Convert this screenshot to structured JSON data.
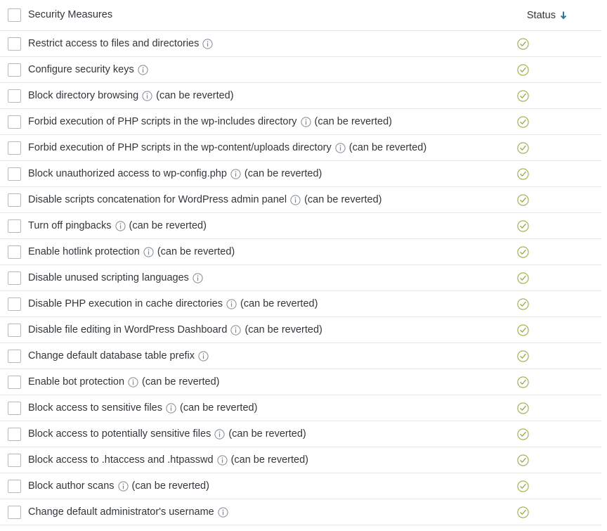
{
  "header": {
    "select_all_checkbox": "unchecked",
    "title": "Security Measures",
    "status_label": "Status",
    "sort_icon": "arrow-down-icon",
    "sort_direction": "descending"
  },
  "colors": {
    "status_ok": "#9aab3f",
    "sort_arrow": "#2a7b9b",
    "text": "#32373c",
    "border": "#e8e8e8",
    "checkbox_border": "#b4b9be",
    "info_icon": "#7e8993",
    "background": "#ffffff"
  },
  "icons": {
    "info": "info-circle-icon",
    "status_ok": "check-circle-icon",
    "checkbox": "checkbox-unchecked-icon"
  },
  "table": {
    "columns": [
      "Security Measures",
      "Status"
    ],
    "rows": [
      {
        "label": "Restrict access to files and directories",
        "info": true,
        "revertable": "",
        "status": "ok",
        "checked": false
      },
      {
        "label": "Configure security keys",
        "info": true,
        "revertable": "",
        "status": "ok",
        "checked": false
      },
      {
        "label": "Block directory browsing",
        "info": true,
        "revertable": "(can be reverted)",
        "status": "ok",
        "checked": false
      },
      {
        "label": "Forbid execution of PHP scripts in the wp-includes directory",
        "info": true,
        "revertable": "(can be reverted)",
        "status": "ok",
        "checked": false
      },
      {
        "label": "Forbid execution of PHP scripts in the wp-content/uploads directory",
        "info": true,
        "revertable": "(can be reverted)",
        "status": "ok",
        "checked": false
      },
      {
        "label": "Block unauthorized access to wp-config.php",
        "info": true,
        "revertable": "(can be reverted)",
        "status": "ok",
        "checked": false
      },
      {
        "label": "Disable scripts concatenation for WordPress admin panel",
        "info": true,
        "revertable": "(can be reverted)",
        "status": "ok",
        "checked": false
      },
      {
        "label": "Turn off pingbacks",
        "info": true,
        "revertable": "(can be reverted)",
        "status": "ok",
        "checked": false
      },
      {
        "label": "Enable hotlink protection",
        "info": true,
        "revertable": "(can be reverted)",
        "status": "ok",
        "checked": false
      },
      {
        "label": "Disable unused scripting languages",
        "info": true,
        "revertable": "",
        "status": "ok",
        "checked": false
      },
      {
        "label": "Disable PHP execution in cache directories",
        "info": true,
        "revertable": "(can be reverted)",
        "status": "ok",
        "checked": false
      },
      {
        "label": "Disable file editing in WordPress Dashboard",
        "info": true,
        "revertable": "(can be reverted)",
        "status": "ok",
        "checked": false
      },
      {
        "label": "Change default database table prefix",
        "info": true,
        "revertable": "",
        "status": "ok",
        "checked": false
      },
      {
        "label": "Enable bot protection",
        "info": true,
        "revertable": "(can be reverted)",
        "status": "ok",
        "checked": false
      },
      {
        "label": "Block access to sensitive files",
        "info": true,
        "revertable": "(can be reverted)",
        "status": "ok",
        "checked": false
      },
      {
        "label": "Block access to potentially sensitive files",
        "info": true,
        "revertable": "(can be reverted)",
        "status": "ok",
        "checked": false
      },
      {
        "label": "Block access to .htaccess and .htpasswd",
        "info": true,
        "revertable": "(can be reverted)",
        "status": "ok",
        "checked": false
      },
      {
        "label": "Block author scans",
        "info": true,
        "revertable": "(can be reverted)",
        "status": "ok",
        "checked": false
      },
      {
        "label": "Change default administrator's username",
        "info": true,
        "revertable": "",
        "status": "ok",
        "checked": false
      }
    ]
  }
}
